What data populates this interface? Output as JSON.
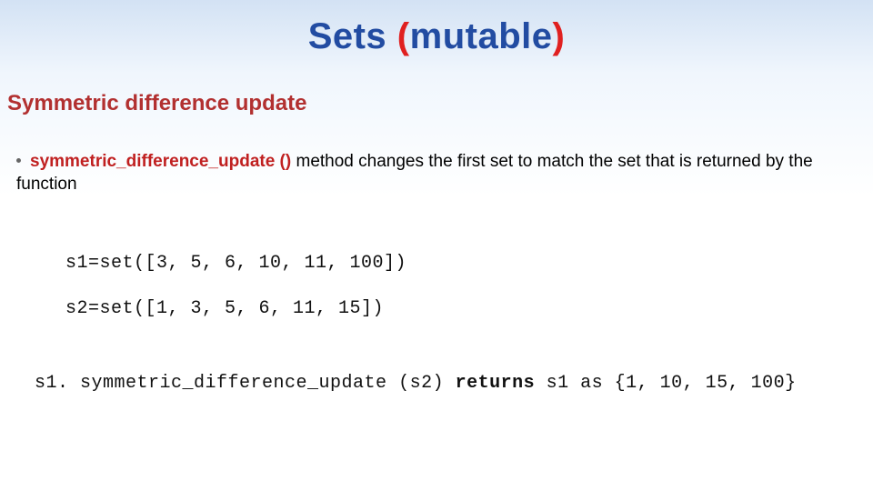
{
  "title": {
    "prefix": "Sets ",
    "paren_open": "(",
    "word": "mutable",
    "paren_close": ")"
  },
  "subtitle": "Symmetric difference update",
  "bullet": {
    "method": "symmetric_difference_update ()",
    "rest": " method changes the first set to match the set that is returned by the function"
  },
  "code": {
    "line1": "s1=set([3, 5, 6, 10, 11, 100])",
    "line2": "s2=set([1, 3, 5, 6, 11, 15])"
  },
  "result": {
    "call": "s1. symmetric_difference_update (s2) ",
    "returns": "returns",
    "tail": " s1 as {1, 10, 15, 100}"
  }
}
